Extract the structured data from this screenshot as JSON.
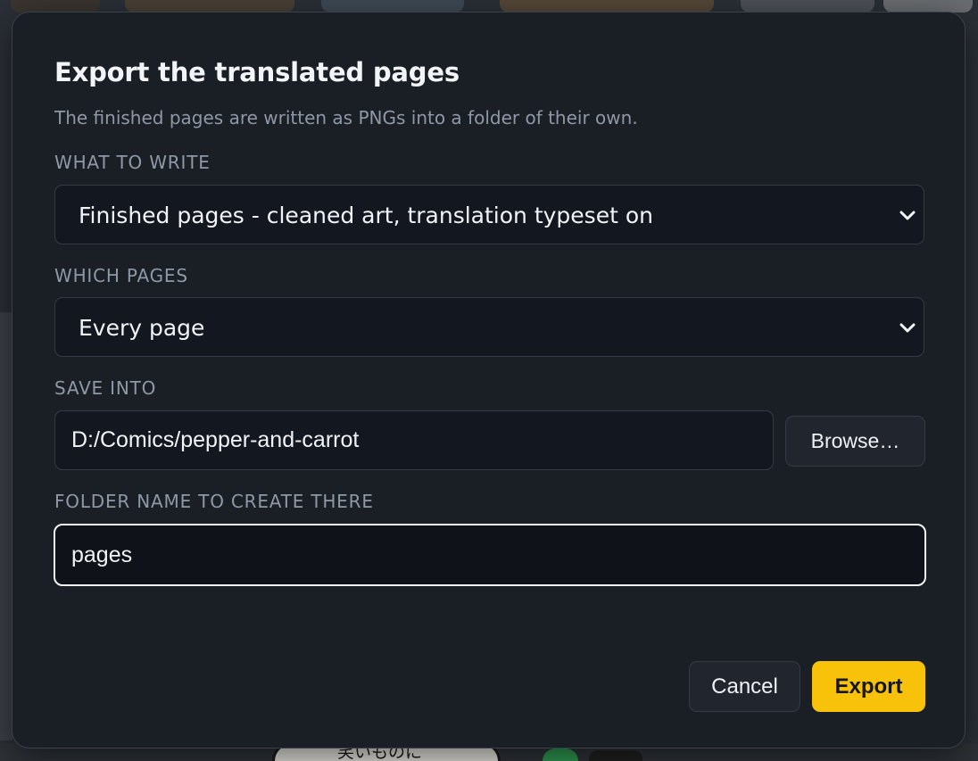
{
  "dialog": {
    "title": "Export the translated pages",
    "subtitle": "The finished pages are written as PNGs into a folder of their own."
  },
  "fields": {
    "what_to_write": {
      "label": "What to write",
      "selected": "Finished pages - cleaned art, translation typeset on",
      "icon": "chevron-down-icon"
    },
    "which_pages": {
      "label": "Which pages",
      "selected": "Every page",
      "icon": "chevron-down-icon"
    },
    "save_into": {
      "label": "Save into",
      "value": "D:/Comics/pepper-and-carrot",
      "browse_label": "Browse…"
    },
    "folder_name": {
      "label": "Folder name to create there",
      "value": "pages"
    }
  },
  "actions": {
    "cancel_label": "Cancel",
    "export_label": "Export"
  },
  "background": {
    "bubble_text": "笑いものに"
  },
  "colors": {
    "accent": "#f8c20a",
    "dialog_bg": "#1a1e25",
    "field_bg": "#131720",
    "focus_border": "#f4f5f7"
  }
}
